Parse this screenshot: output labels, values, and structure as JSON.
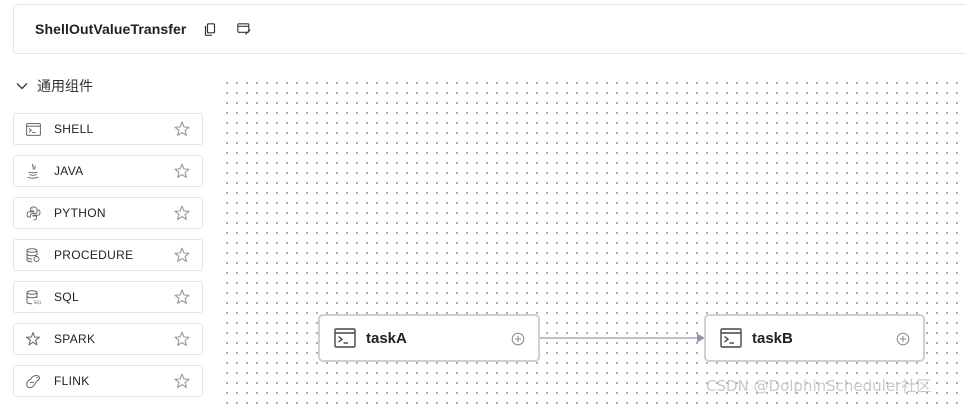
{
  "header": {
    "title": "ShellOutValueTransfer",
    "copy_icon": "copy-icon",
    "edit_icon": "edit-icon"
  },
  "sidebar": {
    "group_label": "通用组件",
    "group_icon": "chevron-down-icon",
    "items": [
      {
        "label": "SHELL",
        "icon": "terminal-icon"
      },
      {
        "label": "JAVA",
        "icon": "java-icon"
      },
      {
        "label": "PYTHON",
        "icon": "python-icon"
      },
      {
        "label": "PROCEDURE",
        "icon": "database-icon"
      },
      {
        "label": "SQL",
        "icon": "sql-icon"
      },
      {
        "label": "SPARK",
        "icon": "spark-icon"
      },
      {
        "label": "FLINK",
        "icon": "flink-icon"
      }
    ]
  },
  "canvas": {
    "nodes": [
      {
        "label": "taskA",
        "icon": "terminal-icon"
      },
      {
        "label": "taskB",
        "icon": "terminal-icon"
      }
    ],
    "edge": {
      "from": "taskA",
      "to": "taskB"
    }
  },
  "watermark": "CSDN @DolphinScheduler社区",
  "colors": {
    "border": "#e3e3e3",
    "node_border": "#cfcfcf",
    "edge": "#8f96a8",
    "text": "#1f1f1f"
  }
}
